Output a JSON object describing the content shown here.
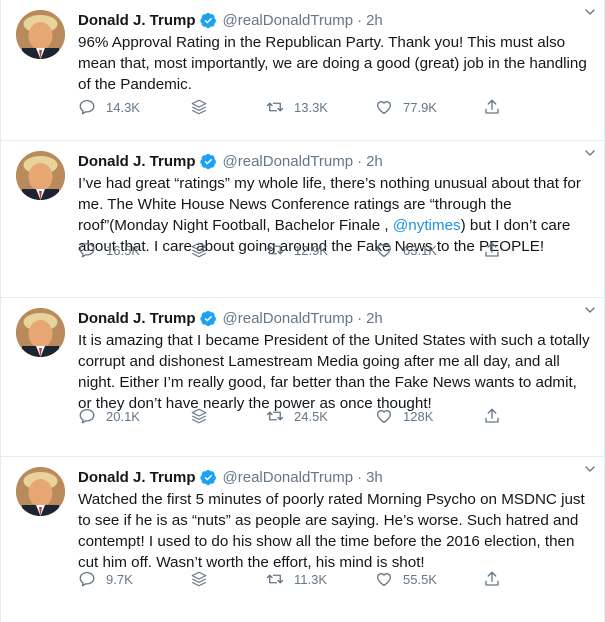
{
  "tweets": [
    {
      "name": "Donald J. Trump",
      "handle": "@realDonaldTrump",
      "sep": "·",
      "time": "2h",
      "text_parts": [
        "96% Approval Rating in the Republican Party. Thank you! This must also mean that, most importantly, we are doing a good (great) job in the handling of the Pandemic."
      ],
      "replies": "14.3K",
      "retweets": "13.3K",
      "likes": "77.9K"
    },
    {
      "name": "Donald J. Trump",
      "handle": "@realDonaldTrump",
      "sep": "·",
      "time": "2h",
      "text_before": "I’ve had great “ratings” my whole life, there’s nothing unusual about that for me. The White House News Conference ratings are “through the roof”(Monday Night Football, Bachelor Finale , ",
      "mention": "@nytimes",
      "text_after": ") but I don’t care about that. I care about going around the Fake News to the PEOPLE!",
      "replies": "16.5K",
      "retweets": "12.9K",
      "likes": "63.1K"
    },
    {
      "name": "Donald J. Trump",
      "handle": "@realDonaldTrump",
      "sep": "·",
      "time": "2h",
      "text_parts": [
        "It is amazing that I became President of the United States with such a totally corrupt and dishonest Lamestream Media going after me all day, and all night. Either I’m really good, far better than the Fake News wants to admit, or they don’t have nearly the power as once thought!"
      ],
      "replies": "20.1K",
      "retweets": "24.5K",
      "likes": "128K"
    },
    {
      "name": "Donald J. Trump",
      "handle": "@realDonaldTrump",
      "sep": "·",
      "time": "3h",
      "text_parts": [
        "Watched the first 5 minutes of poorly rated Morning Psycho on MSDNC just to see if he is as “nuts” as people are saying. He’s worse. Such hatred and contempt! I used to do his show all the time before the 2016 election, then cut him off. Wasn’t worth the effort, his mind is shot!"
      ],
      "replies": "9.7K",
      "retweets": "11.3K",
      "likes": "55.5K"
    }
  ],
  "colors": {
    "text": "#14171a",
    "secondary": "#657786",
    "link": "#1b95e0",
    "verified": "#1da1f2",
    "divider": "#e6ecf0"
  },
  "icons": [
    "reply-icon",
    "stack-icon",
    "retweet-icon",
    "like-icon",
    "share-icon",
    "verified-icon",
    "caret-down-icon"
  ]
}
